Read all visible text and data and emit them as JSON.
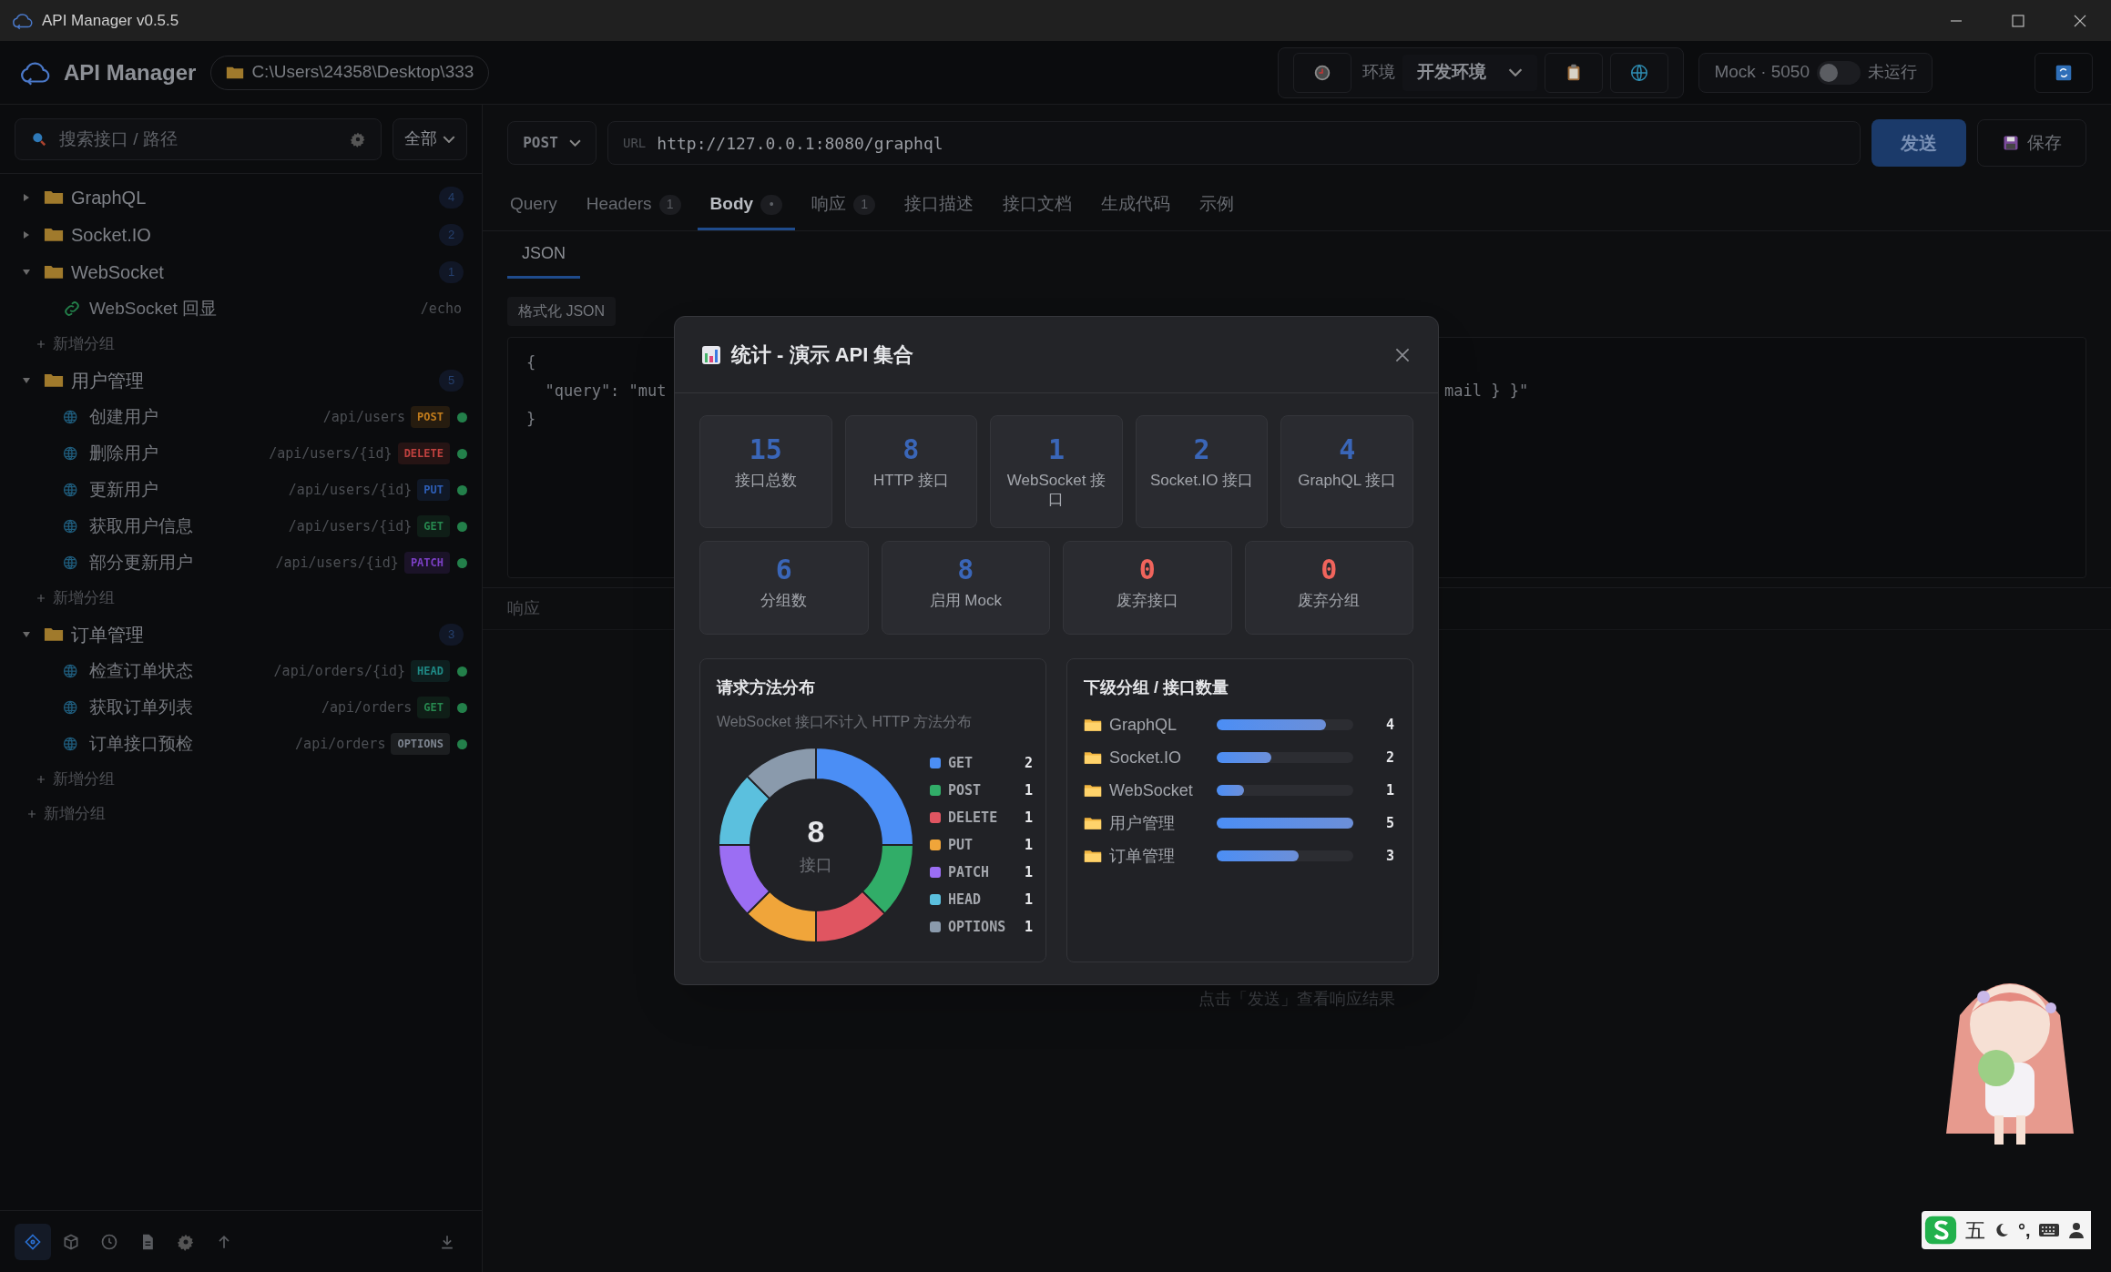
{
  "window": {
    "title": "API Manager v0.5.5"
  },
  "header": {
    "app_name": "API Manager",
    "path": "C:\\Users\\24358\\Desktop\\333",
    "environment": {
      "label": "环境",
      "value": "开发环境"
    },
    "mock": {
      "label": "Mock · 5050",
      "on": false,
      "status": "未运行"
    }
  },
  "sidebar": {
    "search": {
      "placeholder": "搜索接口 / 路径"
    },
    "filter": {
      "value": "全部"
    },
    "tree": [
      {
        "kind": "group",
        "name": "GraphQL",
        "count": "4",
        "expanded": false
      },
      {
        "kind": "group",
        "name": "Socket.IO",
        "count": "2",
        "expanded": false
      },
      {
        "kind": "group",
        "name": "WebSocket",
        "count": "1",
        "expanded": true,
        "children": [
          {
            "kind": "websocket",
            "name": "WebSocket 回显",
            "path": "/echo"
          },
          {
            "kind": "add",
            "label": "新增分组"
          }
        ]
      },
      {
        "kind": "group",
        "name": "用户管理",
        "count": "5",
        "expanded": true,
        "children": [
          {
            "kind": "http",
            "name": "创建用户",
            "path": "/api/users",
            "method": "POST",
            "color": "#c27c1c",
            "enabled": true
          },
          {
            "kind": "http",
            "name": "删除用户",
            "path": "/api/users/{id}",
            "method": "DELETE",
            "color": "#c0413f",
            "enabled": true
          },
          {
            "kind": "http",
            "name": "更新用户",
            "path": "/api/users/{id}",
            "method": "PUT",
            "color": "#2e5fb8",
            "enabled": true
          },
          {
            "kind": "http",
            "name": "获取用户信息",
            "path": "/api/users/{id}",
            "method": "GET",
            "color": "#27884f",
            "enabled": true
          },
          {
            "kind": "http",
            "name": "部分更新用户",
            "path": "/api/users/{id}",
            "method": "PATCH",
            "color": "#7b3fc4",
            "enabled": true
          },
          {
            "kind": "add",
            "label": "新增分组"
          }
        ]
      },
      {
        "kind": "group",
        "name": "订单管理",
        "count": "3",
        "expanded": true,
        "children": [
          {
            "kind": "http",
            "name": "检查订单状态",
            "path": "/api/orders/{id}",
            "method": "HEAD",
            "color": "#1f8a86",
            "enabled": true
          },
          {
            "kind": "http",
            "name": "获取订单列表",
            "path": "/api/orders",
            "method": "GET",
            "color": "#27884f",
            "enabled": true
          },
          {
            "kind": "http",
            "name": "订单接口预检",
            "path": "/api/orders",
            "method": "OPTIONS",
            "color": "#7e8590",
            "enabled": true
          },
          {
            "kind": "add",
            "label": "新增分组"
          }
        ]
      },
      {
        "kind": "add",
        "label": "新增分组"
      }
    ],
    "footer_tools": [
      {
        "selected": true
      },
      {
        "selected": false
      },
      {
        "selected": false
      },
      {
        "selected": false
      },
      {
        "selected": false
      },
      {
        "selected": false
      }
    ]
  },
  "request": {
    "method": "POST",
    "url_label": "URL",
    "url": "http://127.0.0.1:8080/graphql",
    "send": "发送",
    "save": "保存"
  },
  "tabs": [
    {
      "label": "Query",
      "selected": false
    },
    {
      "label": "Headers",
      "badge": "1",
      "selected": false
    },
    {
      "label": "Body",
      "badge": "•",
      "selected": true
    },
    {
      "label": "响应",
      "badge": "1",
      "selected": false
    },
    {
      "label": "接口描述",
      "selected": false
    },
    {
      "label": "接口文档",
      "selected": false
    },
    {
      "label": "生成代码",
      "selected": false
    },
    {
      "label": "示例",
      "selected": false
    }
  ],
  "body_tabs": [
    {
      "label": "JSON",
      "selected": true
    }
  ],
  "format_button": "格式化 JSON",
  "editor": {
    "line_1": "{",
    "line_2_start": "  \"query\": \"mut",
    "line_2_end": "mail } }\"",
    "line_3": "}"
  },
  "response": {
    "label": "响应",
    "hint": "点击「发送」查看响应结果"
  },
  "modal": {
    "title": "统计 - 演示 API 集合",
    "stat_rows": [
      [
        {
          "value": "15",
          "label": "接口总数",
          "alert": false
        },
        {
          "value": "8",
          "label": "HTTP 接口",
          "alert": false
        },
        {
          "value": "1",
          "label": "WebSocket 接口",
          "alert": false
        },
        {
          "value": "2",
          "label": "Socket.IO 接口",
          "alert": false
        },
        {
          "value": "4",
          "label": "GraphQL 接口",
          "alert": false
        }
      ],
      [
        {
          "value": "6",
          "label": "分组数",
          "alert": false
        },
        {
          "value": "8",
          "label": "启用 Mock",
          "alert": false
        },
        {
          "value": "0",
          "label": "废弃接口",
          "alert": true
        },
        {
          "value": "0",
          "label": "废弃分组",
          "alert": true
        }
      ]
    ],
    "method_panel": {
      "title": "请求方法分布",
      "subtitle": "WebSocket 接口不计入 HTTP 方法分布",
      "center_value": "8",
      "center_label": "接口",
      "chart_data": {
        "type": "donut",
        "categories": [
          "GET",
          "POST",
          "DELETE",
          "PUT",
          "PATCH",
          "HEAD",
          "OPTIONS"
        ],
        "values": [
          25,
          12.5,
          12.5,
          12.5,
          12.5,
          12.5,
          12.5
        ]
      },
      "legend": [
        {
          "value": "2",
          "color": "#4b8ef5"
        },
        {
          "value": "1",
          "color": "#31ad68"
        },
        {
          "value": "1",
          "color": "#e05561"
        },
        {
          "value": "1",
          "color": "#f0a53a"
        },
        {
          "value": "1",
          "color": "#9b6ef3"
        },
        {
          "value": "1",
          "color": "#5bc0de"
        },
        {
          "value": "1",
          "color": "#8a9aac"
        }
      ]
    },
    "group_panel": {
      "title": "下级分组 / 接口数量",
      "groups": [
        {
          "name": "GraphQL",
          "count": "4",
          "level": 0.8
        },
        {
          "name": "Socket.IO",
          "count": "2",
          "level": 0.4
        },
        {
          "name": "WebSocket",
          "count": "1",
          "level": 0.2
        },
        {
          "name": "用户管理",
          "count": "5",
          "level": 1
        },
        {
          "name": "订单管理",
          "count": "3",
          "level": 0.6
        }
      ]
    }
  },
  "ime": {
    "mode": "五",
    "punctuation": "°,"
  }
}
